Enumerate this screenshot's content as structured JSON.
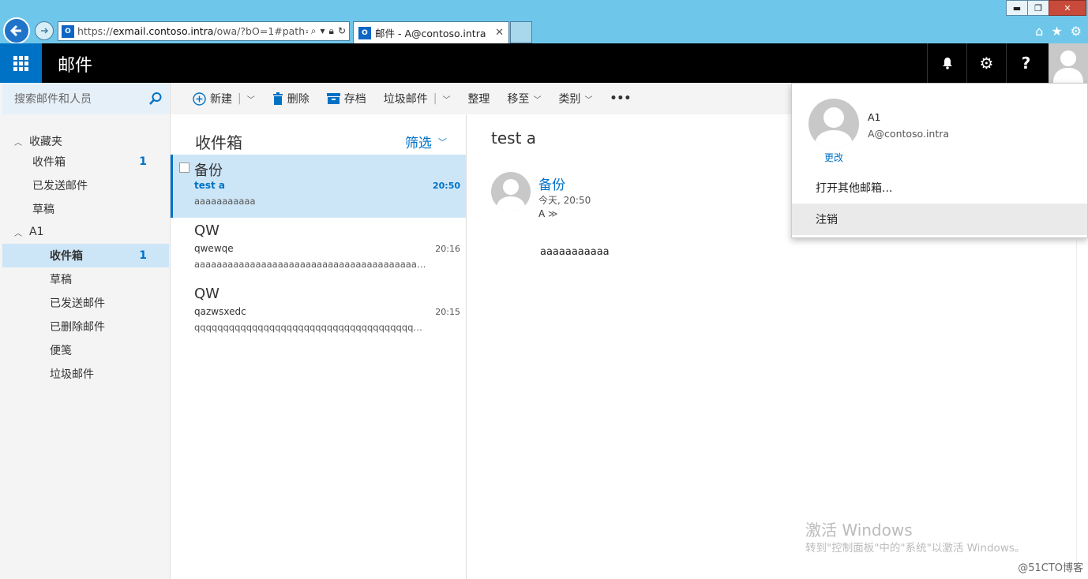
{
  "browser": {
    "url": "https://exmail.contoso.intra/owa/?bO=1#path=",
    "url_host": "exmail.contoso.intra",
    "url_prefix": "https://",
    "url_suffix": "/owa/?bO=1#path=",
    "tab_title": "邮件 - A@contoso.intra",
    "minimize": "▬",
    "restore": "❐",
    "close": "✕",
    "tab_close": "✕"
  },
  "header": {
    "app_title": "邮件",
    "bell_icon": "bell-icon",
    "gear_icon": "gear-icon",
    "help_label": "?"
  },
  "search": {
    "placeholder": "搜索邮件和人员"
  },
  "toolbar": {
    "new_label": "新建",
    "delete_label": "删除",
    "archive_label": "存档",
    "junk_label": "垃圾邮件",
    "sweep_label": "整理",
    "move_label": "移至",
    "category_label": "类别",
    "more_label": "•••"
  },
  "nav": {
    "favorites_label": "收藏夹",
    "favorites": [
      {
        "label": "收件箱",
        "count": "1"
      },
      {
        "label": "已发送邮件",
        "count": ""
      },
      {
        "label": "草稿",
        "count": ""
      }
    ],
    "account_label": "A1",
    "folders": [
      {
        "label": "收件箱",
        "count": "1"
      },
      {
        "label": "草稿",
        "count": ""
      },
      {
        "label": "已发送邮件",
        "count": ""
      },
      {
        "label": "已删除邮件",
        "count": ""
      },
      {
        "label": "便笺",
        "count": ""
      },
      {
        "label": "垃圾邮件",
        "count": ""
      }
    ]
  },
  "maillist": {
    "title": "收件箱",
    "filter_label": "筛选",
    "items": [
      {
        "sender": "备份",
        "subject": "test a",
        "time": "20:50",
        "preview": "aaaaaaaaaaa"
      },
      {
        "sender": "QW",
        "subject": "qwewqe",
        "time": "20:16",
        "preview": "aaaaaaaaaaaaaaaaaaaaaaaaaaaaaaaaaaaaaaaaaaaaaaaaaaaaaaa..."
      },
      {
        "sender": "QW",
        "subject": "qazwsxedc",
        "time": "20:15",
        "preview": "qqqqqqqqqqqqqqqqqqqqqqqqqqqqqqqqqqqqqqqqqqqqqqq..."
      }
    ]
  },
  "reading": {
    "subject": "test a",
    "sender": "备份",
    "date": "今天, 20:50",
    "to": "A",
    "body": "aaaaaaaaaaa"
  },
  "account_menu": {
    "name": "A1",
    "email": "A@contoso.intra",
    "change_label": "更改",
    "open_other_label": "打开其他邮箱...",
    "signout_label": "注销"
  },
  "watermark": {
    "title": "激活 Windows",
    "subtitle": "转到\"控制面板\"中的\"系统\"以激活 Windows。",
    "site": "@51CTO博客"
  },
  "colors": {
    "accent": "#0072c6",
    "header_bg": "#000000",
    "chrome_bg": "#6ec7ea",
    "selected_bg": "#cde6f7"
  }
}
